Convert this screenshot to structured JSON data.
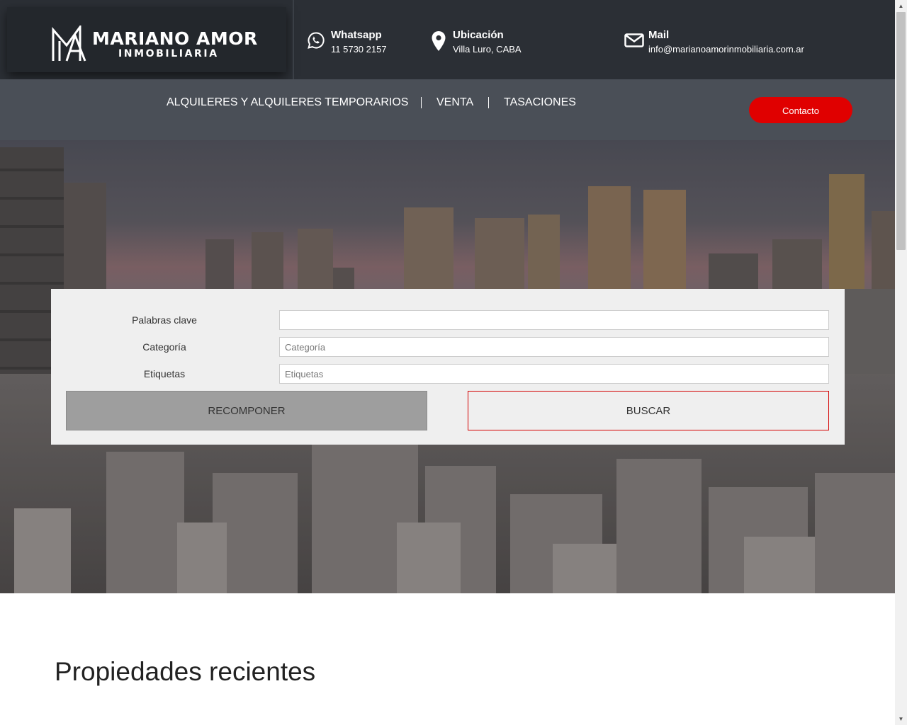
{
  "brand": {
    "name": "MARIANO AMOR",
    "subtitle": "INMOBILIARIA"
  },
  "contacts": {
    "whatsapp": {
      "title": "Whatsapp",
      "value": "11 5730 2157",
      "icon": "whatsapp-icon"
    },
    "location": {
      "title": "Ubicación",
      "value": "Villa Luro, CABA",
      "icon": "map-pin-icon"
    },
    "mail": {
      "title": "Mail",
      "value": "info@marianoamorinmobiliaria.com.ar",
      "icon": "envelope-icon"
    }
  },
  "nav": {
    "items": [
      {
        "label": "ALQUILERES Y ALQUILERES TEMPORARIOS"
      },
      {
        "label": "VENTA"
      },
      {
        "label": "TASACIONES"
      }
    ],
    "contact_button": "Contacto"
  },
  "search": {
    "keywords_label": "Palabras clave",
    "keywords_value": "",
    "category_label": "Categoría",
    "category_placeholder": "Categoría",
    "tags_label": "Etiquetas",
    "tags_placeholder": "Etiquetas",
    "reset_label": "RECOMPONER",
    "search_label": "BUSCAR"
  },
  "recent": {
    "title": "Propiedades recientes"
  },
  "colors": {
    "topbar": "#2b2f35",
    "navbar": "#4a4f57",
    "accent": "#e00000",
    "panel": "#efefef"
  }
}
